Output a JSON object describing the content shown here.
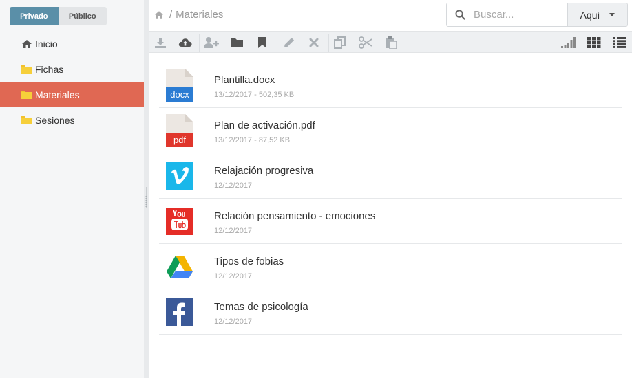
{
  "visibility_toggle": {
    "private_label": "Privado",
    "public_label": "Público",
    "selected": "Privado"
  },
  "sidebar": {
    "items": [
      {
        "label": "Inicio",
        "icon": "home-icon",
        "active": false
      },
      {
        "label": "Fichas",
        "icon": "folder-icon",
        "active": false
      },
      {
        "label": "Materiales",
        "icon": "folder-icon",
        "active": true
      },
      {
        "label": "Sesiones",
        "icon": "folder-icon",
        "active": false
      }
    ]
  },
  "breadcrumb": {
    "separator": "/",
    "current": "Materiales"
  },
  "search": {
    "placeholder": "Buscar...",
    "value": "",
    "scope_label": "Aquí"
  },
  "toolbar": {
    "buttons": [
      "download-icon",
      "upload-cloud-icon",
      "add-user-icon",
      "new-folder-icon",
      "bookmark-icon",
      "edit-pencil-icon",
      "delete-x-icon",
      "copy-icon",
      "cut-scissors-icon",
      "paste-icon",
      "signal-bars-icon",
      "grid-view-icon",
      "list-view-icon"
    ]
  },
  "files": [
    {
      "name": "Plantilla.docx",
      "meta": "13/12/2017 - 502,35 KB",
      "type": "docx",
      "badge": "docx"
    },
    {
      "name": "Plan de activación.pdf",
      "meta": "13/12/2017 - 87,52 KB",
      "type": "pdf",
      "badge": "pdf"
    },
    {
      "name": "Relajación progresiva",
      "meta": "12/12/2017",
      "type": "vimeo"
    },
    {
      "name": "Relación pensamiento - emociones",
      "meta": "12/12/2017",
      "type": "youtube"
    },
    {
      "name": "Tipos de fobias",
      "meta": "12/12/2017",
      "type": "google-drive"
    },
    {
      "name": "Temas de psicología",
      "meta": "12/12/2017",
      "type": "facebook"
    }
  ],
  "colors": {
    "accent": "#e06853",
    "toggle_active": "#5a8fa8",
    "folder": "#f6cf3a",
    "docx": "#2b7cd3",
    "pdf": "#e0362c",
    "vimeo": "#1ab7ea",
    "youtube": "#e52d27",
    "facebook": "#3b5998"
  }
}
